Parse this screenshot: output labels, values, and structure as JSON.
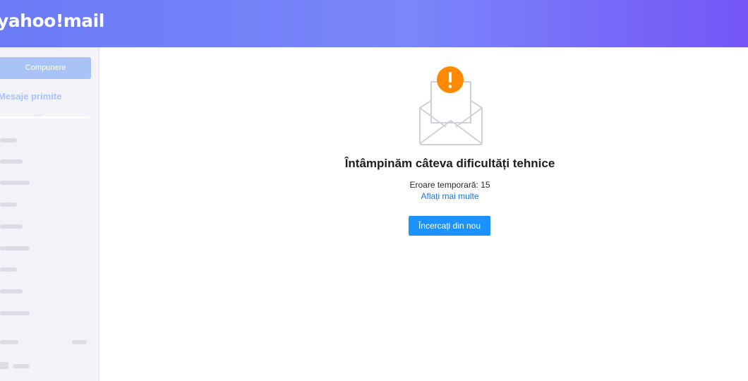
{
  "header": {
    "logo_text": "yahoo!mail"
  },
  "sidebar": {
    "compose_label": "Compunere",
    "inbox_label": "Mesaje primite",
    "more_label": "..."
  },
  "main": {
    "title": "Întâmpinăm câteva dificultăți tehnice",
    "error_text": "Eroare temporară: 15",
    "learn_more_link": "Aflați mai multe",
    "retry_button": "Încercați din nou"
  },
  "colors": {
    "header_gradient_start": "#6a7bf5",
    "header_gradient_end": "#7456f6",
    "compose_button": "#a9c3f8",
    "retry_button": "#1b92ff",
    "warning_badge": "#ff8a00",
    "link": "#1a73e8"
  },
  "icons": [
    "warning-icon",
    "envelope-icon"
  ]
}
